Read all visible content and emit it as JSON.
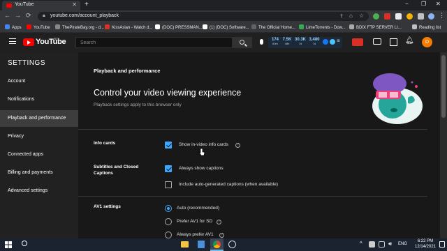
{
  "browser": {
    "tab_title": "YouTube",
    "tab_close": "✕",
    "new_tab": "+",
    "url": "youtube.com/account_playback",
    "window_controls": [
      "−",
      "❐",
      "✕"
    ],
    "nav": [
      "←",
      "→",
      "⟳"
    ],
    "bookmarks": [
      {
        "label": "Apps",
        "color": "#4285f4"
      },
      {
        "label": "YouTube",
        "color": "#ff0000"
      },
      {
        "label": "ThePirateBay.org - d...",
        "color": "#888888"
      },
      {
        "label": "KissAsian - Watch d...",
        "color": "#d93025"
      },
      {
        "label": "(DOC) PRESSMAN...",
        "color": "#ffffff"
      },
      {
        "label": "(1) (DOC) Software...",
        "color": "#ffffff"
      },
      {
        "label": "The Official Home...",
        "color": "#5f6368"
      },
      {
        "label": "LimeTorrents - Dow...",
        "color": "#34a853"
      },
      {
        "label": "BDIX FTP SERVER LI...",
        "color": "#aaaaaa"
      }
    ],
    "reading_list": "Reading list"
  },
  "youtube": {
    "logo_text": "YouTube",
    "country_code": "BD",
    "search_placeholder": "Search",
    "stats": [
      {
        "value": "174",
        "label": "60m"
      },
      {
        "value": "7.5K",
        "label": "48h"
      },
      {
        "value": "30.3K",
        "label": "7d"
      },
      {
        "value": "3,480",
        "label": "7d"
      }
    ],
    "avatar_letter": "D"
  },
  "sidebar": {
    "title": "SETTINGS",
    "items": [
      {
        "label": "Account",
        "active": false
      },
      {
        "label": "Notifications",
        "active": false
      },
      {
        "label": "Playback and performance",
        "active": true
      },
      {
        "label": "Privacy",
        "active": false
      },
      {
        "label": "Connected apps",
        "active": false
      },
      {
        "label": "Billing and payments",
        "active": false
      },
      {
        "label": "Advanced settings",
        "active": false
      }
    ]
  },
  "main": {
    "section_title": "Playback and performance",
    "heading": "Control your video viewing experience",
    "subheading": "Playback settings apply to this browser only",
    "info_cards": {
      "label": "Info cards",
      "option": "Show in-video info cards",
      "checked": true
    },
    "captions": {
      "label": "Subtitles and Closed Captions",
      "options": [
        {
          "text": "Always show captions",
          "checked": true
        },
        {
          "text": "Include auto-generated captions (when available)",
          "checked": false
        }
      ]
    },
    "av1": {
      "label": "AV1 settings",
      "options": [
        {
          "text": "Auto (recommended)",
          "selected": true
        },
        {
          "text": "Prefer AV1 for SD",
          "selected": false
        },
        {
          "text": "Always prefer AV1",
          "selected": false
        }
      ]
    },
    "help_glyph": "?"
  },
  "taskbar": {
    "lang": "ENG",
    "time": "6:22 PM",
    "date": "12/14/2021"
  },
  "colors": {
    "accent": "#3ea6ff",
    "yt_red": "#ff0000",
    "sidebar_bg": "#212121",
    "active_bg": "#3d3d3d"
  }
}
